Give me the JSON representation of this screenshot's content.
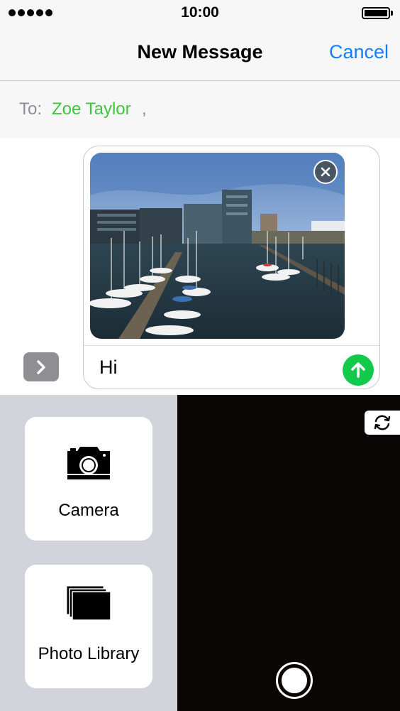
{
  "status_bar": {
    "time": "10:00",
    "signal_icon": "signal-dots-icon",
    "battery_icon": "battery-full-icon"
  },
  "nav": {
    "title": "New Message",
    "cancel_label": "Cancel"
  },
  "to_field": {
    "label": "To:",
    "recipient": "Zoe Taylor",
    "separator": ","
  },
  "compose": {
    "attachment_icon": "harbor-photo-thumbnail",
    "remove_icon": "close-circle-icon",
    "message_text": "Hi",
    "send_icon": "arrow-up-icon",
    "expand_icon": "chevron-right-icon"
  },
  "media_panel": {
    "camera_label": "Camera",
    "camera_icon": "camera-icon",
    "library_label": "Photo Library",
    "library_icon": "photo-stack-icon",
    "flip_icon": "camera-flip-icon",
    "shutter_icon": "shutter-icon"
  },
  "colors": {
    "accent_blue": "#157efb",
    "recipient_green": "#3ec63f",
    "send_green": "#11c94a",
    "panel_gray": "#d1d4db",
    "camera_bg": "#0b0606"
  }
}
